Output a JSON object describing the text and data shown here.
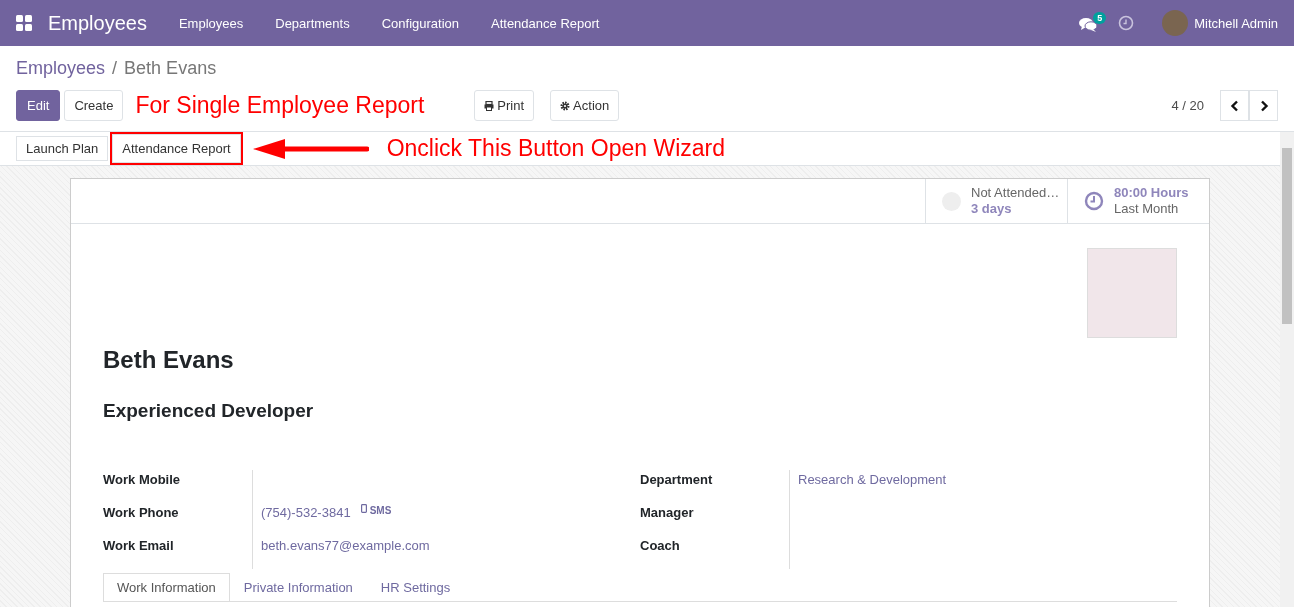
{
  "navbar": {
    "app_name": "Employees",
    "menu": [
      "Employees",
      "Departments",
      "Configuration",
      "Attendance Report"
    ],
    "messages_count": "5",
    "user": "Mitchell Admin"
  },
  "breadcrumb": [
    "Employees",
    "Beth Evans"
  ],
  "breadcrumb_separator": "/",
  "buttons": {
    "primary": "Edit",
    "secondary": "Create",
    "print": "Print",
    "action": "Action"
  },
  "note_top": "For Single Employee Report",
  "pager": "4 / 20",
  "header_buttons": [
    {
      "label": "Launch Plan",
      "highlighted": false
    },
    {
      "label": "Attendance Report",
      "highlighted": true
    }
  ],
  "note_arrow": "Onclick This Button Open Wizard",
  "smart_buttons": [
    {
      "kind": "presence",
      "label": "Not Attended…",
      "value": "3 days"
    },
    {
      "kind": "hours",
      "value": "80:00 Hours",
      "label": "Last Month"
    }
  ],
  "employee": {
    "name": "Beth Evans",
    "job_title": "Experienced Developer"
  },
  "fields_left": [
    {
      "label": "Work Mobile"
    },
    {
      "label": "Work Phone",
      "value": "(754)-532-3841",
      "sms": "SMS"
    },
    {
      "label": "Work Email",
      "value": "beth.evans77@example.com"
    }
  ],
  "fields_right": [
    {
      "label": "Department",
      "value": "Research & Development"
    },
    {
      "label": "Manager"
    },
    {
      "label": "Coach"
    }
  ],
  "tabs": [
    {
      "label": "Work Information",
      "selected": true
    },
    {
      "label": "Private Information",
      "selected": false
    },
    {
      "label": "HR Settings",
      "selected": false
    }
  ]
}
